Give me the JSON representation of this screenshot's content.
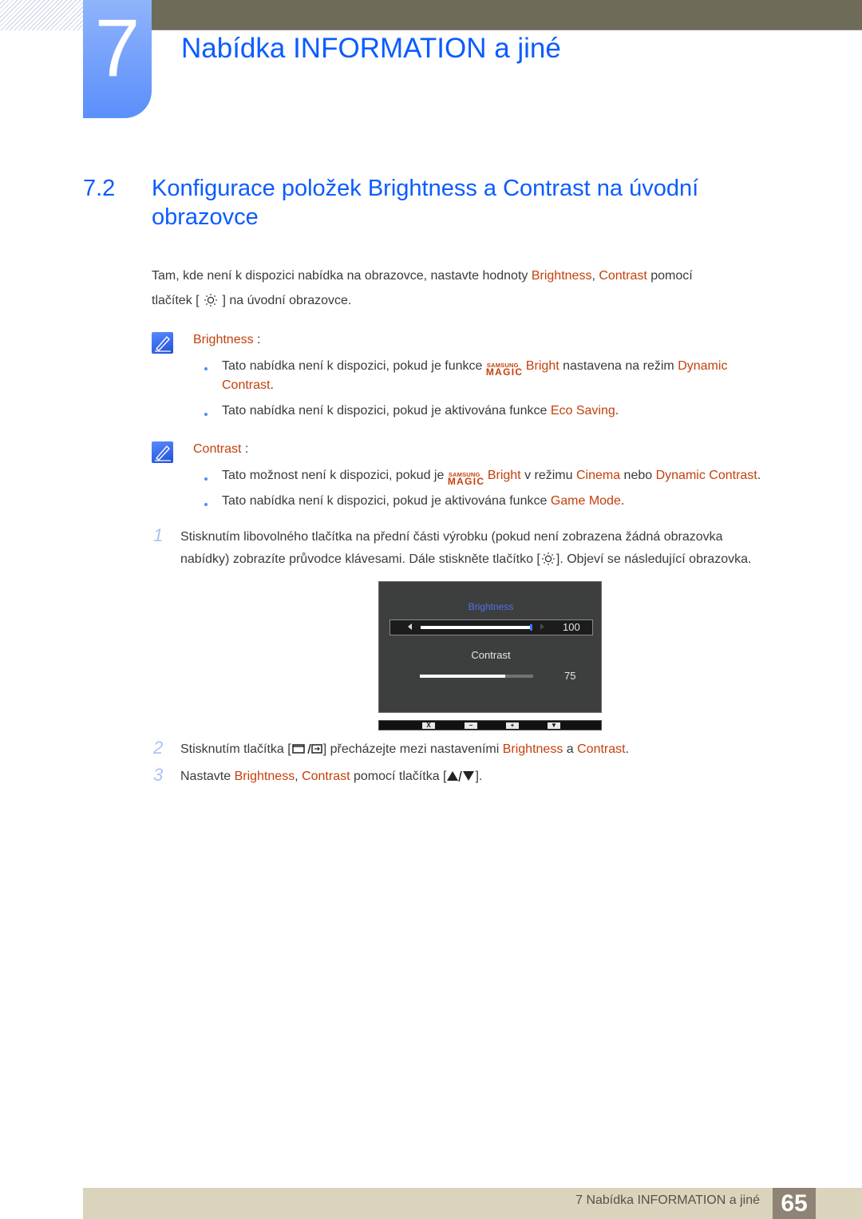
{
  "header": {
    "chapter_number": "7",
    "chapter_title": "Nabídka INFORMATION a jiné"
  },
  "section": {
    "number": "7.2",
    "title": "Konfigurace položek Brightness a Contrast na úvodní obrazovce"
  },
  "intro": {
    "text_1": "Tam, kde není k dispozici nabídka na obrazovce, nastavte hodnoty ",
    "hl_brightness": "Brightness",
    "sep": ", ",
    "hl_contrast": "Contrast",
    "text_2": " pomocí",
    "text_3": "tlačítek [",
    "text_4": "] na úvodní obrazovce.",
    "icon": "brightness-sun-icon"
  },
  "notes": [
    {
      "label": "Brightness",
      "label_suffix": " :",
      "icon": "note-pencil-icon",
      "bullets": [
        {
          "pre": "Tato nabídka není k dispozici, pokud je funkce ",
          "magic_top": "SAMSUNG",
          "magic_bottom": "MAGIC",
          "magic_word": "Bright",
          "mid": " nastavena na režim ",
          "hl": "Dynamic",
          "line2_hl": "Contrast",
          "line2_end": "."
        },
        {
          "pre": "Tato nabídka není k dispozici, pokud je aktivována funkce ",
          "hl": "Eco Saving",
          "end": "."
        }
      ]
    },
    {
      "label": "Contrast",
      "label_suffix": " :",
      "icon": "note-pencil-icon",
      "bullets": [
        {
          "pre": "Tato možnost není k dispozici, pokud je ",
          "magic_top": "SAMSUNG",
          "magic_bottom": "MAGIC",
          "magic_word": "Bright",
          "mid": " v režimu ",
          "hl": "Cinema",
          "mid2": " nebo ",
          "hl2": "Dynamic Contrast",
          "end": "."
        },
        {
          "pre": "Tato nabídka není k dispozici, pokud je aktivována funkce ",
          "hl": "Game Mode",
          "end": "."
        }
      ]
    }
  ],
  "steps": [
    {
      "number": "1",
      "line1": "Stisknutím libovolného tlačítka na přední části výrobku (pokud není zobrazena žádná obrazovka",
      "line2_pre": "nabídky) zobrazíte průvodce klávesami. Dále stiskněte tlačítko [",
      "line2_post": "]. Objeví se následující obrazovka."
    },
    {
      "number": "2",
      "pre": "Stisknutím tlačítka [",
      "post": "] přecházejte mezi nastaveními ",
      "hl1": "Brightness",
      "mid": " a ",
      "hl2": "Contrast",
      "end": "."
    },
    {
      "number": "3",
      "pre": "Nastavte ",
      "hl1": "Brightness",
      "sep": ", ",
      "hl2": "Contrast",
      "mid": " pomocí tlačítka [",
      "end": "]."
    }
  ],
  "osd": {
    "brightness_label": "Brightness",
    "brightness_value": "100",
    "brightness_fraction": 1.0,
    "contrast_label": "Contrast",
    "contrast_value": "75",
    "contrast_fraction": 0.75,
    "keys": [
      "X",
      "−",
      "+",
      "▼"
    ]
  },
  "footer": {
    "chapter_ref": "7 Nabídka INFORMATION a jiné",
    "page_number": "65"
  },
  "colors": {
    "heading_blue": "#0b5cff",
    "highlight_orange": "#c4400b",
    "top_bar": "#6e6b58",
    "footer_bar": "#dbd4bd",
    "page_badge": "#8e8374"
  }
}
